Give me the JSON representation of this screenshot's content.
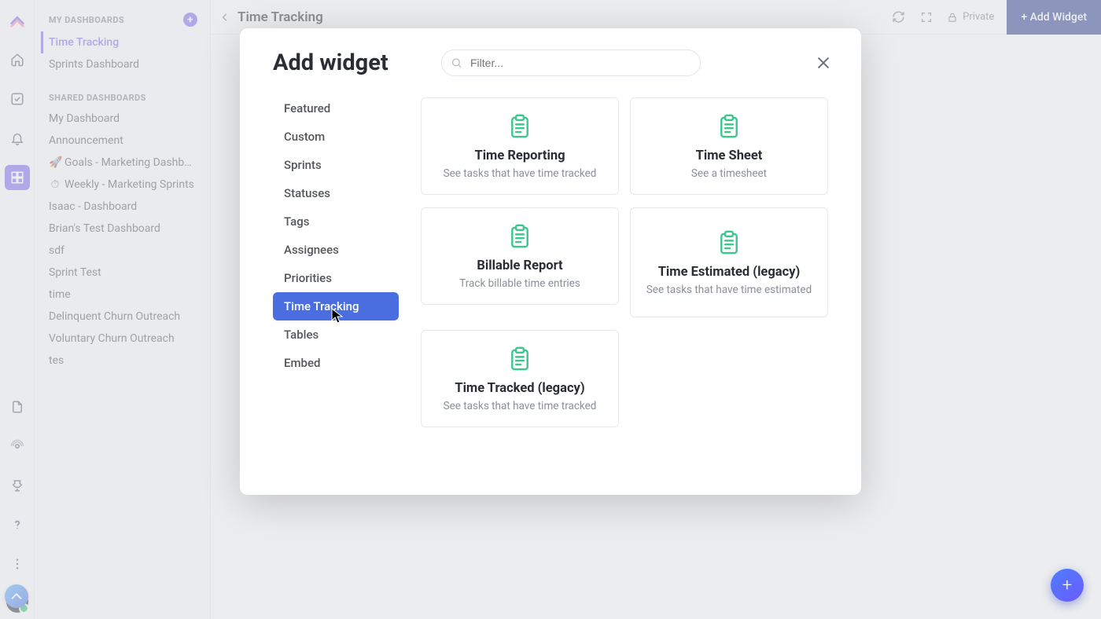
{
  "header": {
    "page_title": "Time Tracking",
    "private_label": "Private",
    "add_widget_btn": "+ Add Widget"
  },
  "sidebar": {
    "section_my": "MY DASHBOARDS",
    "section_shared": "SHARED DASHBOARDS",
    "active_index": 0,
    "my_items": [
      {
        "label": "Time Tracking"
      },
      {
        "label": "Sprints Dashboard"
      }
    ],
    "shared_items": [
      {
        "label": "My Dashboard"
      },
      {
        "label": "Announcement"
      },
      {
        "label": "Goals - Marketing Dashboa…",
        "pre": "🚀"
      },
      {
        "label": "Weekly - Marketing Sprints",
        "pre": "⏱"
      },
      {
        "label": "Isaac - Dashboard"
      },
      {
        "label": "Brian's Test Dashboard"
      },
      {
        "label": "sdf"
      },
      {
        "label": "Sprint Test"
      },
      {
        "label": "time"
      },
      {
        "label": "Delinquent Churn Outreach"
      },
      {
        "label": "Voluntary Churn Outreach"
      },
      {
        "label": "tes"
      }
    ]
  },
  "modal": {
    "title": "Add widget",
    "search_placeholder": "Filter...",
    "active_category_index": 7,
    "categories": [
      "Featured",
      "Custom",
      "Sprints",
      "Statuses",
      "Tags",
      "Assignees",
      "Priorities",
      "Time Tracking",
      "Tables",
      "Embed"
    ],
    "widgets": [
      {
        "title": "Time Reporting",
        "desc": "See tasks that have time tracked"
      },
      {
        "title": "Time Sheet",
        "desc": "See a timesheet"
      },
      {
        "title": "Billable Report",
        "desc": "Track billable time entries"
      },
      {
        "title": "Time Estimated (legacy)",
        "desc": "See tasks that have time estimated"
      },
      {
        "title": "Time Tracked (legacy)",
        "desc": "See tasks that have time tracked"
      }
    ]
  },
  "colors": {
    "accent": "#4a6ee0",
    "purple": "#7b68ee",
    "widget_icon": "#3cc78f"
  }
}
